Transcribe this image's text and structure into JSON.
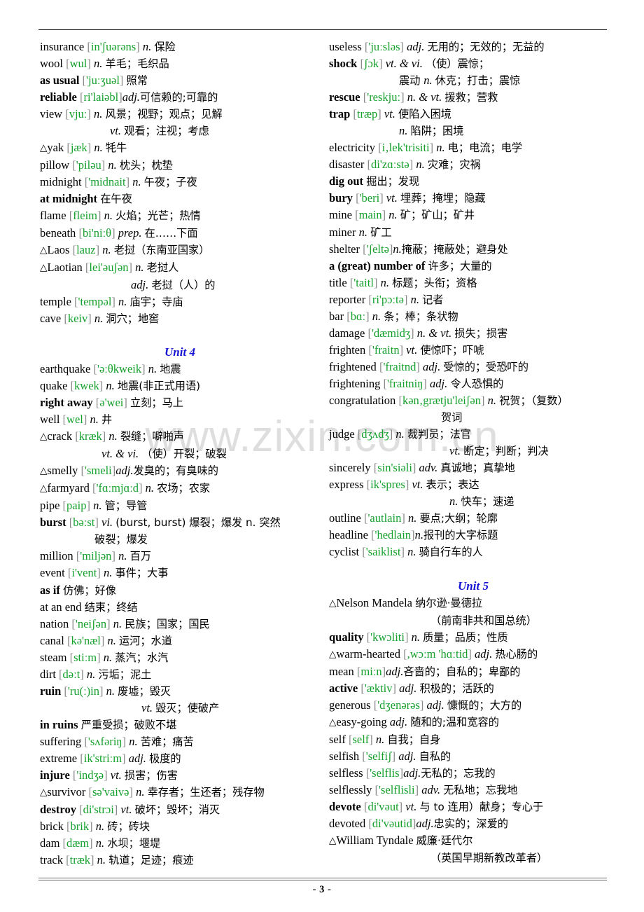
{
  "document": {
    "page_number": "- 3 -",
    "watermark": "www.zixin.com.cn",
    "accent_unit_heading_color": "#1414d2",
    "phonetic_color": "#15a02c"
  },
  "left_column": {
    "entries": [
      {
        "head": "insurance",
        "bold": false,
        "tri": false,
        "ph": "in'ʃuərəns",
        "pos": "n.",
        "cn": "保险"
      },
      {
        "head": "wool",
        "bold": false,
        "tri": false,
        "ph": "wul",
        "pos": "n.",
        "cn": "羊毛；毛织品"
      },
      {
        "head": "as usual",
        "bold": true,
        "tri": false,
        "ph": "'juːʒuəl",
        "pos": "",
        "cn": "照常"
      },
      {
        "head": "reliable",
        "bold": true,
        "tri": false,
        "ph": "ri'laiəbl",
        "pos": "adj.",
        "cn": "可信赖的;可靠的",
        "tight": true
      },
      {
        "head": "view",
        "bold": false,
        "tri": false,
        "ph": "vjuː",
        "pos": "n.",
        "cn": "风景；视野；观点；见解"
      },
      {
        "cont": 100,
        "pos": "vt.",
        "cn": "观看；注视；考虑"
      },
      {
        "head": "yak",
        "bold": false,
        "tri": true,
        "ph": "jæk",
        "pos": "n.",
        "cn": "牦牛"
      },
      {
        "head": "pillow",
        "bold": false,
        "tri": false,
        "ph": "'piləu",
        "pos": "n.",
        "cn": "枕头；枕垫"
      },
      {
        "head": "midnight",
        "bold": false,
        "tri": false,
        "ph": "'midnait",
        "pos": "n.",
        "cn": "午夜；子夜"
      },
      {
        "head": "at midnight",
        "bold": true,
        "tri": false,
        "ph": "",
        "pos": "",
        "cn": "在午夜"
      },
      {
        "head": "flame",
        "bold": false,
        "tri": false,
        "ph": "fleim",
        "pos": "n.",
        "cn": "火焰；光芒；热情"
      },
      {
        "head": "beneath",
        "bold": false,
        "tri": false,
        "ph": "bi'niːθ",
        "pos": "prep.",
        "cn": "在……下面"
      },
      {
        "head": "Laos",
        "bold": false,
        "tri": true,
        "ph": "lauz",
        "pos": "n.",
        "cn": "老挝（东南亚国家）"
      },
      {
        "head": "Laotian",
        "bold": false,
        "tri": true,
        "ph": "lei'əuʃən",
        "pos": "n.",
        "cn": "老挝人"
      },
      {
        "cont": 130,
        "pos": "adj.",
        "cn": "老挝（人）的"
      },
      {
        "head": "temple",
        "bold": false,
        "tri": false,
        "ph": "'tempəl",
        "pos": "n.",
        "cn": "庙宇；寺庙"
      },
      {
        "head": "cave",
        "bold": false,
        "tri": false,
        "ph": "keiv",
        "pos": "n.",
        "cn": "洞穴；地窖"
      }
    ],
    "unit_heading": "Unit 4",
    "entries2": [
      {
        "head": "earthquake",
        "bold": false,
        "tri": false,
        "ph": "'əːθkweik",
        "pos": "n.",
        "cn": "地震"
      },
      {
        "head": "quake",
        "bold": false,
        "tri": false,
        "ph": "kwek",
        "pos": "n.",
        "cn": "地震(非正式用语)"
      },
      {
        "head": "right away",
        "bold": true,
        "tri": false,
        "ph": "ə'wei",
        "pos": "",
        "cn": "立刻；马上"
      },
      {
        "head": "well",
        "bold": false,
        "tri": false,
        "ph": "wel",
        "pos": "n.",
        "cn": "井"
      },
      {
        "head": "crack",
        "bold": false,
        "tri": true,
        "ph": "kræk",
        "pos": "n.",
        "cn": "裂缝；噼啪声"
      },
      {
        "cont": 88,
        "pos": "vt. & vi.",
        "cn": "（使）开裂；破裂"
      },
      {
        "head": "smelly",
        "bold": false,
        "tri": true,
        "ph": "'smeli",
        "pos": "adj.",
        "cn": "发臭的；有臭味的",
        "tight": true
      },
      {
        "head": "farmyard",
        "bold": false,
        "tri": true,
        "ph": "'fɑːmjɑːd",
        "pos": "n.",
        "cn": "农场；农家"
      },
      {
        "head": "pipe",
        "bold": false,
        "tri": false,
        "ph": "paip",
        "pos": "n.",
        "cn": "管；导管"
      },
      {
        "head": "burst",
        "bold": true,
        "tri": false,
        "ph": "bəːst",
        "pos": "vi.",
        "cn": "(burst, burst)  爆裂；爆发   n.  突然"
      },
      {
        "cont": 78,
        "pos": "",
        "cn": "破裂；爆发"
      },
      {
        "head": "million",
        "bold": false,
        "tri": false,
        "ph": "'miljən",
        "pos": "n.",
        "cn": "百万"
      },
      {
        "head": "event",
        "bold": false,
        "tri": false,
        "ph": "i'vent",
        "pos": "n.",
        "cn": "事件；大事"
      },
      {
        "head": "as if",
        "bold": true,
        "tri": false,
        "ph": "",
        "pos": "",
        "cn": "仿佛；好像"
      },
      {
        "head": "at an end",
        "bold": false,
        "tri": false,
        "ph": "",
        "pos": "",
        "cn": "结束；终结"
      },
      {
        "head": "nation",
        "bold": false,
        "tri": false,
        "ph": "'neiʃən",
        "pos": "n.",
        "cn": "民族；国家；国民"
      },
      {
        "head": "canal",
        "bold": false,
        "tri": false,
        "ph": "kə'næl",
        "pos": "n.",
        "cn": "运河；水道"
      },
      {
        "head": "steam",
        "bold": false,
        "tri": false,
        "ph": "stiːm",
        "pos": "n.",
        "cn": "蒸汽；水汽"
      },
      {
        "head": "dirt",
        "bold": false,
        "tri": false,
        "ph": "dəːt",
        "pos": "n.",
        "cn": "污垢；泥土"
      },
      {
        "head": "ruin",
        "bold": true,
        "tri": false,
        "ph": "'ru(ː)in",
        "pos": "n.",
        "cn": "废墟；毁灭"
      },
      {
        "cont": 145,
        "pos": "vt.",
        "cn": "毁灭；使破产"
      },
      {
        "head": "in ruins",
        "bold": true,
        "tri": false,
        "ph": "",
        "pos": "",
        "cn": "严重受损；破败不堪"
      },
      {
        "head": "suffering",
        "bold": false,
        "tri": false,
        "ph": "'sʌfəriŋ",
        "pos": "n.",
        "cn": "苦难；痛苦"
      },
      {
        "head": "extreme",
        "bold": false,
        "tri": false,
        "ph": "ik'striːm",
        "pos": "adj.",
        "cn": "极度的"
      },
      {
        "head": "injure",
        "bold": true,
        "tri": false,
        "ph": "'indʒə",
        "pos": "vt.",
        "cn": "损害；伤害"
      },
      {
        "head": "survivor",
        "bold": false,
        "tri": true,
        "ph": "sə'vaivə",
        "pos": "n.",
        "cn": "幸存者；生还者；残存物"
      },
      {
        "head": "destroy",
        "bold": true,
        "tri": false,
        "ph": "di'strɔi",
        "pos": "vt.",
        "cn": "破坏；毁坏；消灭"
      },
      {
        "head": "brick",
        "bold": false,
        "tri": false,
        "ph": "brik",
        "pos": "n.",
        "cn": "砖；砖块"
      },
      {
        "head": "dam",
        "bold": false,
        "tri": false,
        "ph": "dæm",
        "pos": "n.",
        "cn": "水坝；堰堤"
      },
      {
        "head": "track",
        "bold": false,
        "tri": false,
        "ph": "træk",
        "pos": "n.",
        "cn": "轨道；足迹；痕迹"
      }
    ]
  },
  "right_column": {
    "entries": [
      {
        "head": "useless",
        "bold": false,
        "tri": false,
        "ph": "'juːsləs",
        "pos": "adj.",
        "cn": "无用的；无效的；无益的"
      },
      {
        "head": "shock",
        "bold": true,
        "tri": false,
        "ph": "ʃɔk",
        "pos": "vt. & vi.",
        "cn": "（使）震惊；"
      },
      {
        "cont": 100,
        "pos": "",
        "cn": "震动 ",
        "pos2": "n.",
        "cn2": "休克；打击；震惊"
      },
      {
        "head": "rescue",
        "bold": true,
        "tri": false,
        "ph": "'reskjuː",
        "pos": "n. & vt.",
        "cn": "援救；营救"
      },
      {
        "head": "trap",
        "bold": true,
        "tri": false,
        "ph": "træp",
        "pos": "vt.",
        "cn": "使陷入困境"
      },
      {
        "cont": 100,
        "pos": "n.",
        "cn": "陷阱；困境"
      },
      {
        "head": "electricity",
        "bold": false,
        "tri": false,
        "ph": "i‚lek'trisiti",
        "pos": "n.",
        "cn": "电；电流；电学"
      },
      {
        "head": "disaster",
        "bold": false,
        "tri": false,
        "ph": "di'zɑːstə",
        "pos": "n.",
        "cn": "灾难；灾祸"
      },
      {
        "head": "dig out",
        "bold": true,
        "tri": false,
        "ph": "",
        "pos": "",
        "cn": "掘出；发现"
      },
      {
        "head": "bury",
        "bold": true,
        "tri": false,
        "ph": "'beri",
        "pos": "vt.",
        "cn": "埋葬；掩埋；隐藏"
      },
      {
        "head": "mine",
        "bold": false,
        "tri": false,
        "ph": "main",
        "pos": "n.",
        "cn": "矿；矿山；矿井"
      },
      {
        "head": "miner",
        "bold": false,
        "tri": false,
        "ph": "",
        "pos": "n.",
        "cn": "矿工"
      },
      {
        "head": "shelter",
        "bold": false,
        "tri": false,
        "ph": "'ʃeltə",
        "pos": "n.",
        "cn": "掩蔽；掩蔽处；避身处",
        "tight": true
      },
      {
        "head": "a (great) number of",
        "bold": true,
        "tri": false,
        "ph": "",
        "pos": "",
        "cn": "许多；大量的"
      },
      {
        "head": "title",
        "bold": false,
        "tri": false,
        "ph": "'taitl",
        "pos": "n.",
        "cn": "标题；头衔；资格"
      },
      {
        "head": "reporter",
        "bold": false,
        "tri": false,
        "ph": "ri'pɔːtə",
        "pos": "n.",
        "cn": "记者"
      },
      {
        "head": "bar",
        "bold": false,
        "tri": false,
        "ph": "bɑː",
        "pos": "n.",
        "cn": "条；棒；条状物"
      },
      {
        "head": "damage",
        "bold": false,
        "tri": false,
        "ph": "'dæmidʒ",
        "pos": "n. & vt.",
        "cn": "损失；损害"
      },
      {
        "head": "frighten",
        "bold": false,
        "tri": false,
        "ph": "'fraitn",
        "pos": "vt.",
        "cn": "使惊吓；吓唬"
      },
      {
        "head": "frightened",
        "bold": false,
        "tri": false,
        "ph": "'fraitnd",
        "pos": "adj.",
        "cn": "受惊的；受恐吓的"
      },
      {
        "head": "frightening",
        "bold": false,
        "tri": false,
        "ph": "'fraitniŋ",
        "pos": "adj.",
        "cn": "令人恐惧的"
      },
      {
        "head": "congratulation",
        "bold": false,
        "tri": false,
        "ph": "kən‚grætju'leiʃən",
        "pos": "n.",
        "cn": "祝贺；（复数）",
        "wide_gap": true
      },
      {
        "cont": 160,
        "pos": "",
        "cn": "贺词"
      },
      {
        "head": "judge",
        "bold": false,
        "tri": false,
        "ph": "dʒʌdʒ",
        "pos": "n.",
        "cn": "裁判员；法官"
      },
      {
        "cont": 172,
        "pos": "vt.",
        "cn": "断定；判断；判决"
      },
      {
        "head": "sincerely",
        "bold": false,
        "tri": false,
        "ph": "sin'siəli",
        "pos": "adv.",
        "cn": "真诚地；真挚地"
      },
      {
        "head": "express",
        "bold": false,
        "tri": false,
        "ph": "ik'spres",
        "pos": "vt.",
        "cn": "表示；表达"
      },
      {
        "cont": 172,
        "pos": "n.",
        "cn": "快车；速递"
      },
      {
        "head": "outline",
        "bold": false,
        "tri": false,
        "ph": "'autlain",
        "pos": "n.",
        "cn": "要点;大纲；轮廓"
      },
      {
        "head": "headline",
        "bold": false,
        "tri": false,
        "ph": "'hedlain",
        "pos": "n.",
        "cn": "报刊的大字标题",
        "tight": true
      },
      {
        "head": "cyclist",
        "bold": false,
        "tri": false,
        "ph": "'saiklist",
        "pos": "n.",
        "cn": "骑自行车的人"
      }
    ],
    "unit_heading": "Unit 5",
    "entries2": [
      {
        "head": "Nelson Mandela",
        "bold": false,
        "tri": true,
        "ph": "",
        "pos": "",
        "cn": "纳尔逊·曼德拉"
      },
      {
        "cont": 145,
        "pos": "",
        "cn": "（前南非共和国总统）"
      },
      {
        "head": "quality",
        "bold": true,
        "tri": false,
        "ph": "'kwɔliti",
        "pos": "n.",
        "cn": "质量；品质；性质"
      },
      {
        "head": "warm-hearted",
        "bold": false,
        "tri": true,
        "ph": ",wɔːm 'hɑːtid",
        "pos": "adj.",
        "cn": "热心肠的"
      },
      {
        "head": "mean",
        "bold": false,
        "tri": false,
        "ph": "miːn",
        "pos": "adj.",
        "cn": "吝啬的；自私的；卑鄙的",
        "tight": true
      },
      {
        "head": "active",
        "bold": true,
        "tri": false,
        "ph": "'æktiv",
        "pos": "adj.",
        "cn": "积极的；活跃的"
      },
      {
        "head": "generous",
        "bold": false,
        "tri": false,
        "ph": "'dʒenərəs",
        "pos": "adj.",
        "cn": "慷慨的；大方的"
      },
      {
        "head": "easy-going",
        "bold": false,
        "tri": true,
        "ph": "",
        "pos": "adj.",
        "cn": "随和的;温和宽容的"
      },
      {
        "head": "self",
        "bold": false,
        "tri": false,
        "ph": "self",
        "pos": "n.",
        "cn": "自我；自身"
      },
      {
        "head": "selfish",
        "bold": false,
        "tri": false,
        "ph": "'selfiʃ",
        "pos": "adj.",
        "cn": "自私的"
      },
      {
        "head": "selfless",
        "bold": false,
        "tri": false,
        "ph": "'selflis",
        "pos": "adj.",
        "cn": "无私的；忘我的",
        "tight": true
      },
      {
        "head": "selflessly",
        "bold": false,
        "tri": false,
        "ph": "'selflisli",
        "pos": "adv.",
        "cn": "无私地；忘我地"
      },
      {
        "head": "devote",
        "bold": true,
        "tri": false,
        "ph": "di'vəut",
        "pos": "vt.",
        "cn": "与 to 连用）献身；专心于",
        "wide_gap": true
      },
      {
        "head": "devoted",
        "bold": false,
        "tri": false,
        "ph": "di'vəutid",
        "pos": "adj.",
        "cn": "忠实的；深爱的",
        "tight": true
      },
      {
        "head": "William Tyndale",
        "bold": false,
        "tri": true,
        "ph": "",
        "pos": "",
        "cn": "威廉·廷代尔"
      },
      {
        "cont": 145,
        "pos": "",
        "cn": "（英国早期新教改革者）"
      }
    ]
  }
}
